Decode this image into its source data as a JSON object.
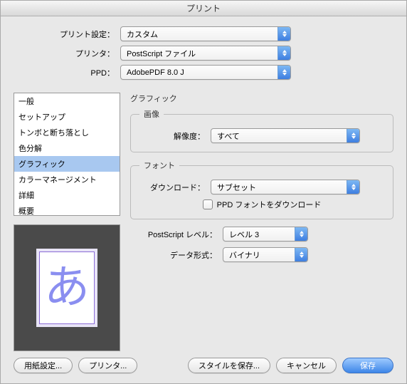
{
  "window": {
    "title": "プリント"
  },
  "top": {
    "preset_label": "プリント設定：",
    "preset_value": "カスタム",
    "printer_label": "プリンタ：",
    "printer_value": "PostScript ファイル",
    "ppd_label": "PPD：",
    "ppd_value": "AdobePDF 8.0 J"
  },
  "sidebar": {
    "items": [
      "一般",
      "セットアップ",
      "トンボと断ち落とし",
      "色分解",
      "グラフィック",
      "カラーマネージメント",
      "詳細",
      "概要"
    ],
    "selected_index": 4
  },
  "preview": {
    "glyph": "あ"
  },
  "section": {
    "title": "グラフィック",
    "image": {
      "legend": "画像",
      "resolution_label": "解像度：",
      "resolution_value": "すべて"
    },
    "font": {
      "legend": "フォント",
      "download_label": "ダウンロード：",
      "download_value": "サブセット",
      "ppd_download_label": "PPD フォントをダウンロード"
    },
    "ps_level_label": "PostScript レベル：",
    "ps_level_value": "レベル 3",
    "data_format_label": "データ形式：",
    "data_format_value": "バイナリ"
  },
  "buttons": {
    "page_setup": "用紙設定...",
    "printer": "プリンタ...",
    "save_style": "スタイルを保存...",
    "cancel": "キャンセル",
    "save": "保存"
  }
}
